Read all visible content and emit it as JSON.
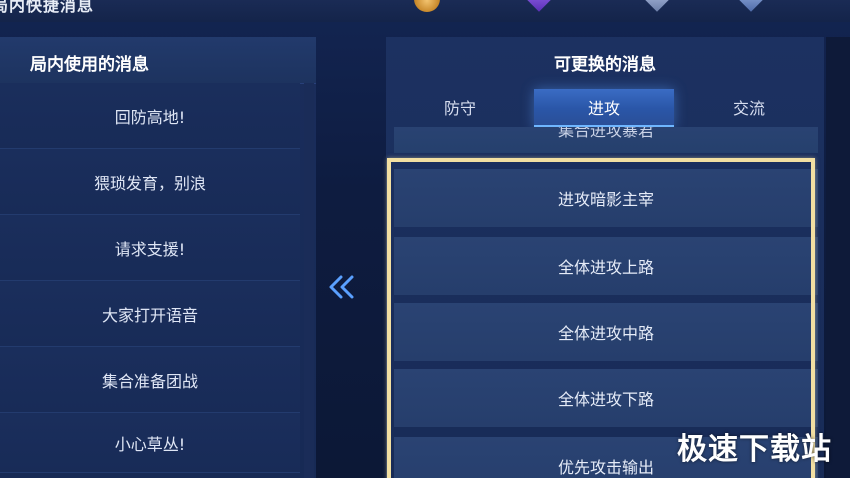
{
  "header": {
    "title": "局内快捷消息"
  },
  "left_panel": {
    "title": "局内使用的消息",
    "items": [
      {
        "label": "回防高地!"
      },
      {
        "label": "猥琐发育，别浪"
      },
      {
        "label": "请求支援!"
      },
      {
        "label": "大家打开语音"
      },
      {
        "label": "集合准备团战"
      },
      {
        "label": "小心草丛!"
      }
    ]
  },
  "transfer": {
    "icon": "double-chevron-left-icon"
  },
  "right_panel": {
    "title": "可更换的消息",
    "tabs": [
      {
        "label": "防守"
      },
      {
        "label": "进攻",
        "active": true
      },
      {
        "label": "交流"
      }
    ],
    "items": [
      {
        "label": "集合进攻暴君"
      },
      {
        "label": "进攻暗影主宰"
      },
      {
        "label": "全体进攻上路"
      },
      {
        "label": "全体进攻中路"
      },
      {
        "label": "全体进攻下路"
      },
      {
        "label": "优先攻击输出"
      }
    ]
  },
  "watermark": {
    "text": "极速下载站"
  },
  "colors": {
    "selection_border": "#f2dfa2",
    "active_tab": "#3a6cc4",
    "panel_bg": "#1a2d5b"
  }
}
